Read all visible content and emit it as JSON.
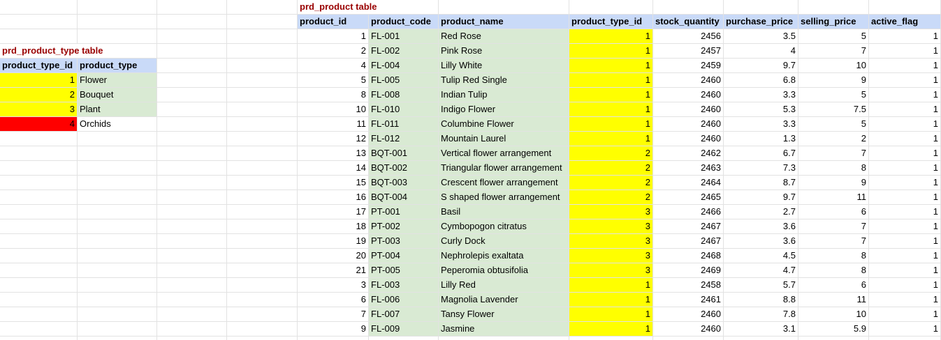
{
  "product_type_table": {
    "title": "prd_product_type table",
    "headers": [
      "product_type_id",
      "product_type"
    ],
    "rows": [
      [
        1,
        "Flower"
      ],
      [
        2,
        "Bouquet"
      ],
      [
        3,
        "Plant"
      ],
      [
        4,
        "Orchids"
      ]
    ]
  },
  "product_table": {
    "title": "prd_product table",
    "headers": [
      "product_id",
      "product_code",
      "product_name",
      "product_type_id",
      "stock_quantity",
      "purchase_price",
      "selling_price",
      "active_flag"
    ],
    "rows": [
      [
        1,
        "FL-001",
        "Red Rose",
        1,
        2456,
        3.5,
        5,
        1
      ],
      [
        2,
        "FL-002",
        "Pink Rose",
        1,
        2457,
        4,
        7,
        1
      ],
      [
        4,
        "FL-004",
        "Lilly White",
        1,
        2459,
        9.7,
        10,
        1
      ],
      [
        5,
        "FL-005",
        "Tulip Red Single",
        1,
        2460,
        6.8,
        9,
        1
      ],
      [
        8,
        "FL-008",
        "Indian Tulip",
        1,
        2460,
        3.3,
        5,
        1
      ],
      [
        10,
        "FL-010",
        "Indigo Flower",
        1,
        2460,
        5.3,
        7.5,
        1
      ],
      [
        11,
        "FL-011",
        "Columbine Flower",
        1,
        2460,
        3.3,
        5,
        1
      ],
      [
        12,
        "FL-012",
        "Mountain Laurel",
        1,
        2460,
        1.3,
        2,
        1
      ],
      [
        13,
        "BQT-001",
        "Vertical flower arrangement",
        2,
        2462,
        6.7,
        7,
        1
      ],
      [
        14,
        "BQT-002",
        "Triangular flower arrangement",
        2,
        2463,
        7.3,
        8,
        1
      ],
      [
        15,
        "BQT-003",
        "Crescent flower arrangement",
        2,
        2464,
        8.7,
        9,
        1
      ],
      [
        16,
        "BQT-004",
        "S shaped flower arrangement",
        2,
        2465,
        9.7,
        11,
        1
      ],
      [
        17,
        "PT-001",
        "Basil",
        3,
        2466,
        2.7,
        6,
        1
      ],
      [
        18,
        "PT-002",
        "Cymbopogon citratus",
        3,
        2467,
        3.6,
        7,
        1
      ],
      [
        19,
        "PT-003",
        "Curly Dock",
        3,
        2467,
        3.6,
        7,
        1
      ],
      [
        20,
        "PT-004",
        "Nephrolepis exaltata",
        3,
        2468,
        4.5,
        8,
        1
      ],
      [
        21,
        "PT-005",
        "Peperomia obtusifolia",
        3,
        2469,
        4.7,
        8,
        1
      ],
      [
        3,
        "FL-003",
        "Lilly Red",
        1,
        2458,
        5.7,
        6,
        1
      ],
      [
        6,
        "FL-006",
        "Magnolia Lavender",
        1,
        2461,
        8.8,
        11,
        1
      ],
      [
        7,
        "FL-007",
        "Tansy Flower",
        1,
        2460,
        7.8,
        10,
        1
      ],
      [
        9,
        "FL-009",
        "Jasmine",
        1,
        2460,
        3.1,
        5.9,
        1
      ]
    ]
  },
  "colors": {
    "header_fill": "#c9daf8",
    "title_text": "#990000",
    "text_fill": "#d9ead3",
    "fk_fill": "#ffff00",
    "missing_fill": "#ff0000"
  }
}
